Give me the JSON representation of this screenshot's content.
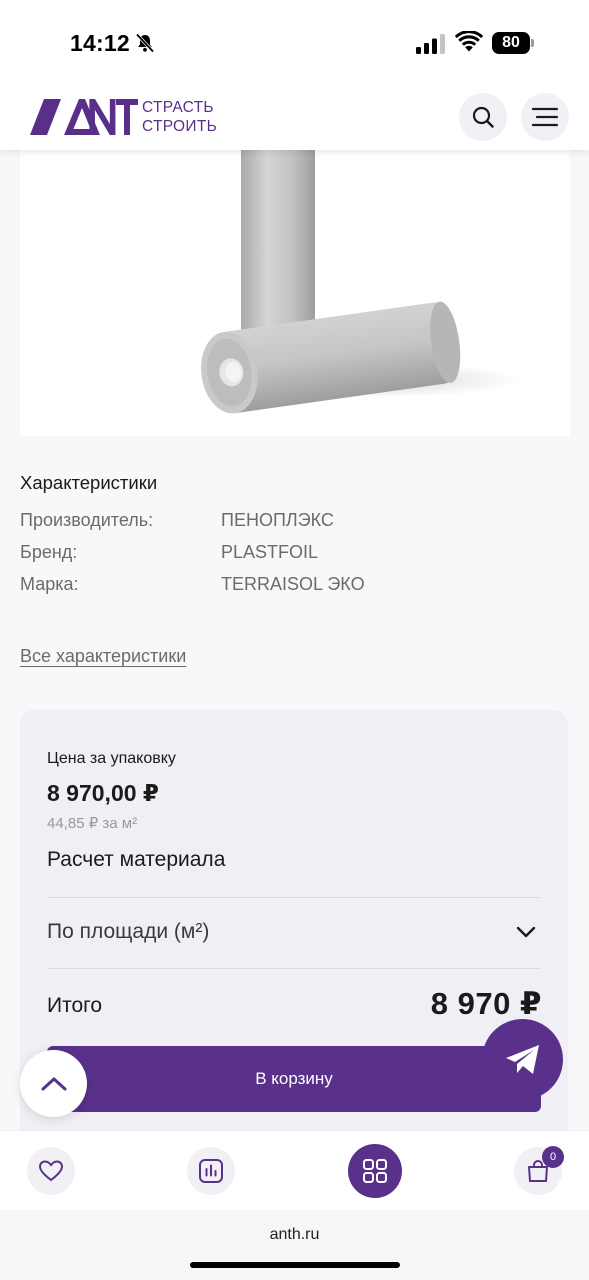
{
  "status_bar": {
    "time": "14:12",
    "battery": "80"
  },
  "header": {
    "logo_text": "ANT",
    "tagline_line1": "СТРАСТЬ",
    "tagline_line2": "СТРОИТЬ",
    "brand_color": "#5a2f8a"
  },
  "product": {
    "image": "membrane-rolls-image"
  },
  "specs": {
    "title": "Характеристики",
    "rows": [
      {
        "label": "Производитель:",
        "value": "ПЕНОПЛЭКС"
      },
      {
        "label": "Бренд:",
        "value": "PLASTFOIL"
      },
      {
        "label": "Марка:",
        "value": "TERRAISOL ЭКО"
      }
    ],
    "all_link": "Все характеристики"
  },
  "price_card": {
    "price_label": "Цена за упаковку",
    "price": "8 970,00 ₽",
    "price_per_unit": "44,85 ₽ за м²",
    "calc_title": "Расчет материала",
    "calc_mode": "По площади (м²)",
    "total_label": "Итого",
    "total_value": "8 970 ₽",
    "add_to_cart": "В корзину"
  },
  "bottom_nav": {
    "cart_count": "0",
    "items": [
      "favorites-icon",
      "compare-icon",
      "catalog-icon",
      "cart-icon"
    ]
  },
  "browser": {
    "url": "anth.ru"
  },
  "colors": {
    "accent": "#59318a",
    "card_bg": "#f0eff5",
    "page_bg": "#f8f8fb"
  }
}
